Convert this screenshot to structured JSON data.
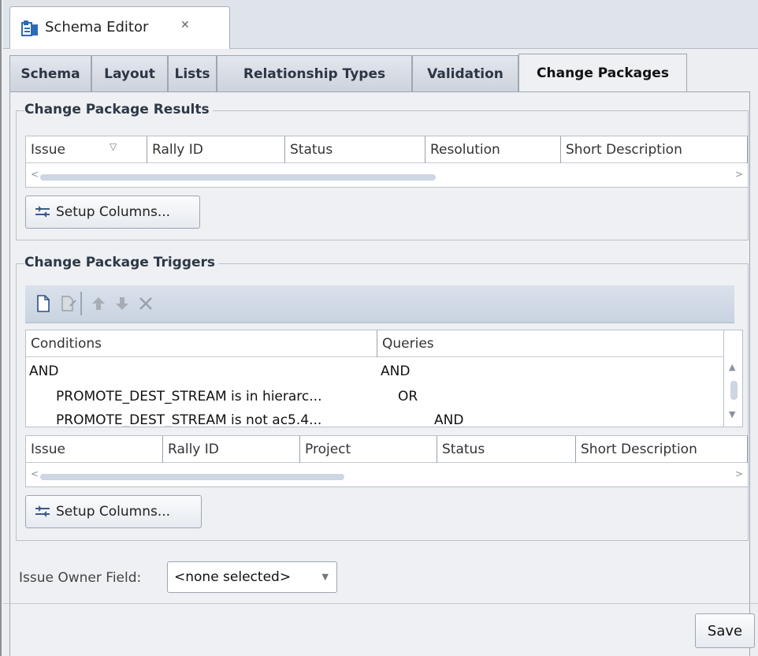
{
  "editor_tab": {
    "title": "Schema Editor",
    "close_glyph": "✕",
    "icon": "schema-editor-icon"
  },
  "tabs": [
    {
      "label": "Schema"
    },
    {
      "label": "Layout"
    },
    {
      "label": "Lists"
    },
    {
      "label": "Relationship Types"
    },
    {
      "label": "Validation"
    },
    {
      "label": "Change Packages",
      "active": true
    }
  ],
  "results": {
    "title": "Change Package Results",
    "columns": [
      "Issue",
      "Rally ID",
      "Status",
      "Resolution",
      "Short Description"
    ],
    "setup_button": "Setup Columns..."
  },
  "triggers": {
    "title": "Change Package Triggers",
    "toolbar": [
      "new-icon",
      "edit-icon",
      "move-up-icon",
      "move-down-icon",
      "delete-icon"
    ],
    "tree_columns": [
      "Conditions",
      "Queries"
    ],
    "tree_rows": [
      {
        "condition": "AND",
        "query": "AND"
      },
      {
        "condition": "PROMOTE_DEST_STREAM is in hierarc...",
        "query": "OR"
      },
      {
        "condition": "PROMOTE_DEST_STREAM is not ac5.4...",
        "query": "AND"
      }
    ],
    "columns": [
      "Issue",
      "Rally ID",
      "Project",
      "Status",
      "Short Description"
    ],
    "setup_button": "Setup Columns..."
  },
  "owner": {
    "label": "Issue Owner Field:",
    "value": "<none selected>"
  },
  "save_label": "Save",
  "colors": {
    "tab_active": "#eef0f3",
    "toolbar": "#cfd8e4",
    "border": "#9ea6b2"
  }
}
